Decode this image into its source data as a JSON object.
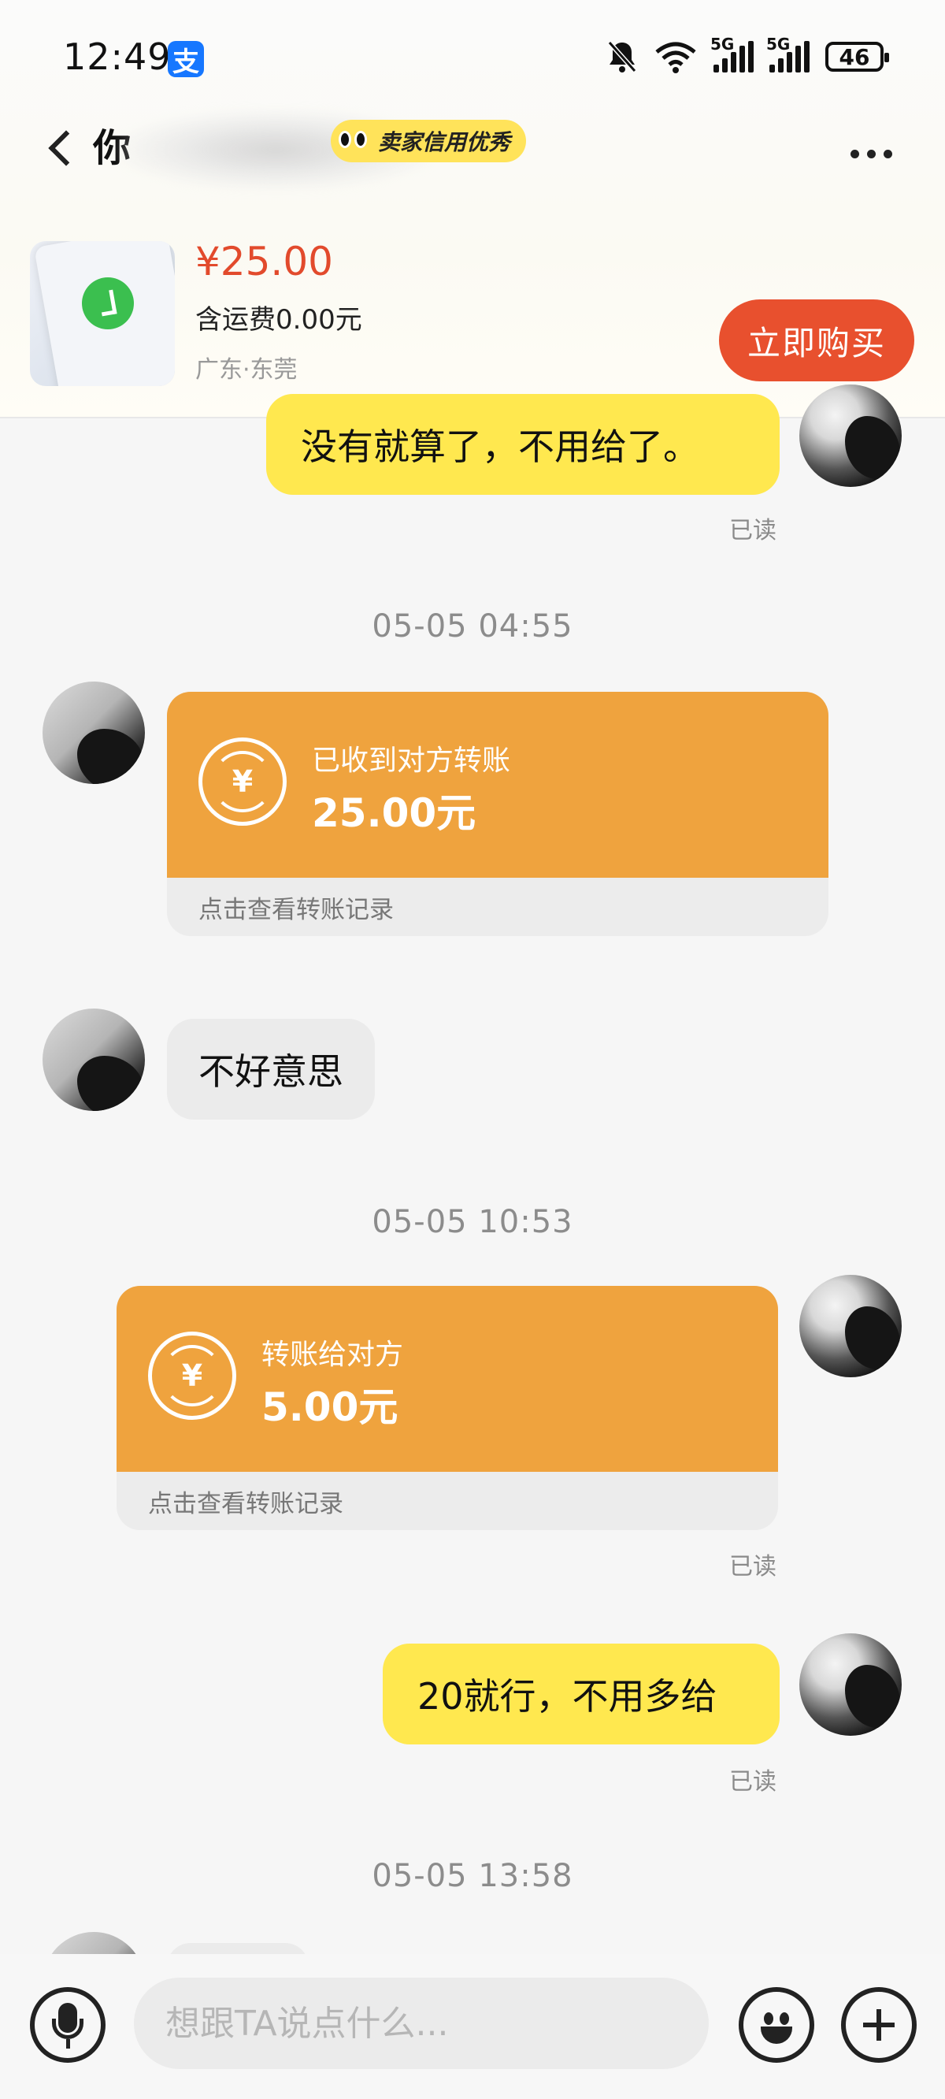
{
  "status_bar": {
    "time": "12:49",
    "app_badge": "支",
    "signal_1_label": "5G",
    "signal_2_label": "5G",
    "battery": "46"
  },
  "header": {
    "contact_name": "你",
    "credit_badge": "卖家信用优秀"
  },
  "product": {
    "price": "¥25.00",
    "shipping": "含运费0.00元",
    "location": "广东·东莞",
    "buy_label": "立即购买"
  },
  "messages": {
    "m1": {
      "text": "没有就算了，不用给了。",
      "read": "已读"
    },
    "t1": "05-05 04:55",
    "transfer1": {
      "title": "已收到对方转账",
      "amount": "25.00元",
      "footer": "点击查看转账记录"
    },
    "m2": {
      "text": "不好意思"
    },
    "t2": "05-05 10:53",
    "transfer2": {
      "title": "转账给对方",
      "amount": "5.00元",
      "footer": "点击查看转账记录",
      "read": "已读"
    },
    "m3": {
      "text": "20就行，不用多给",
      "read": "已读"
    },
    "t3": "05-05 13:58"
  },
  "input_bar": {
    "placeholder": "想跟TA说点什么..."
  },
  "icons": {
    "back": "chevron-left-icon",
    "more": "more-dots-icon",
    "mic": "microphone-icon",
    "emoji": "emoji-icon",
    "plus": "plus-icon",
    "yen": "yen-transfer-icon"
  },
  "colors": {
    "accent_yellow": "#ffe84f",
    "transfer_orange": "#efa33e",
    "buy_button": "#e8502e",
    "price_red": "#e24a2c"
  }
}
